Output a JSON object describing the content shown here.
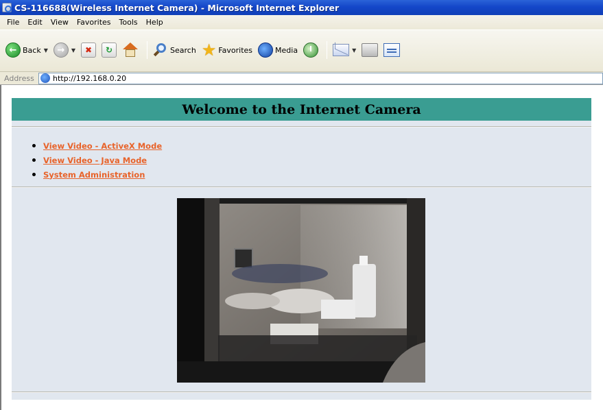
{
  "window": {
    "title": "CS-116688(Wireless Internet Camera) - Microsoft Internet Explorer"
  },
  "menu": [
    "File",
    "Edit",
    "View",
    "Favorites",
    "Tools",
    "Help"
  ],
  "toolbar": {
    "back_label": "Back",
    "search_label": "Search",
    "favorites_label": "Favorites",
    "media_label": "Media"
  },
  "address": {
    "label": "Address",
    "url": "http://192.168.0.20"
  },
  "page": {
    "heading": "Welcome to the Internet Camera",
    "links": [
      "View Video - ActiveX Mode",
      "View Video - Java Mode",
      "System Administration"
    ],
    "colors": {
      "header_bg": "#3a9d92",
      "page_bg": "#e1e7ef",
      "link": "#e8632a"
    }
  }
}
